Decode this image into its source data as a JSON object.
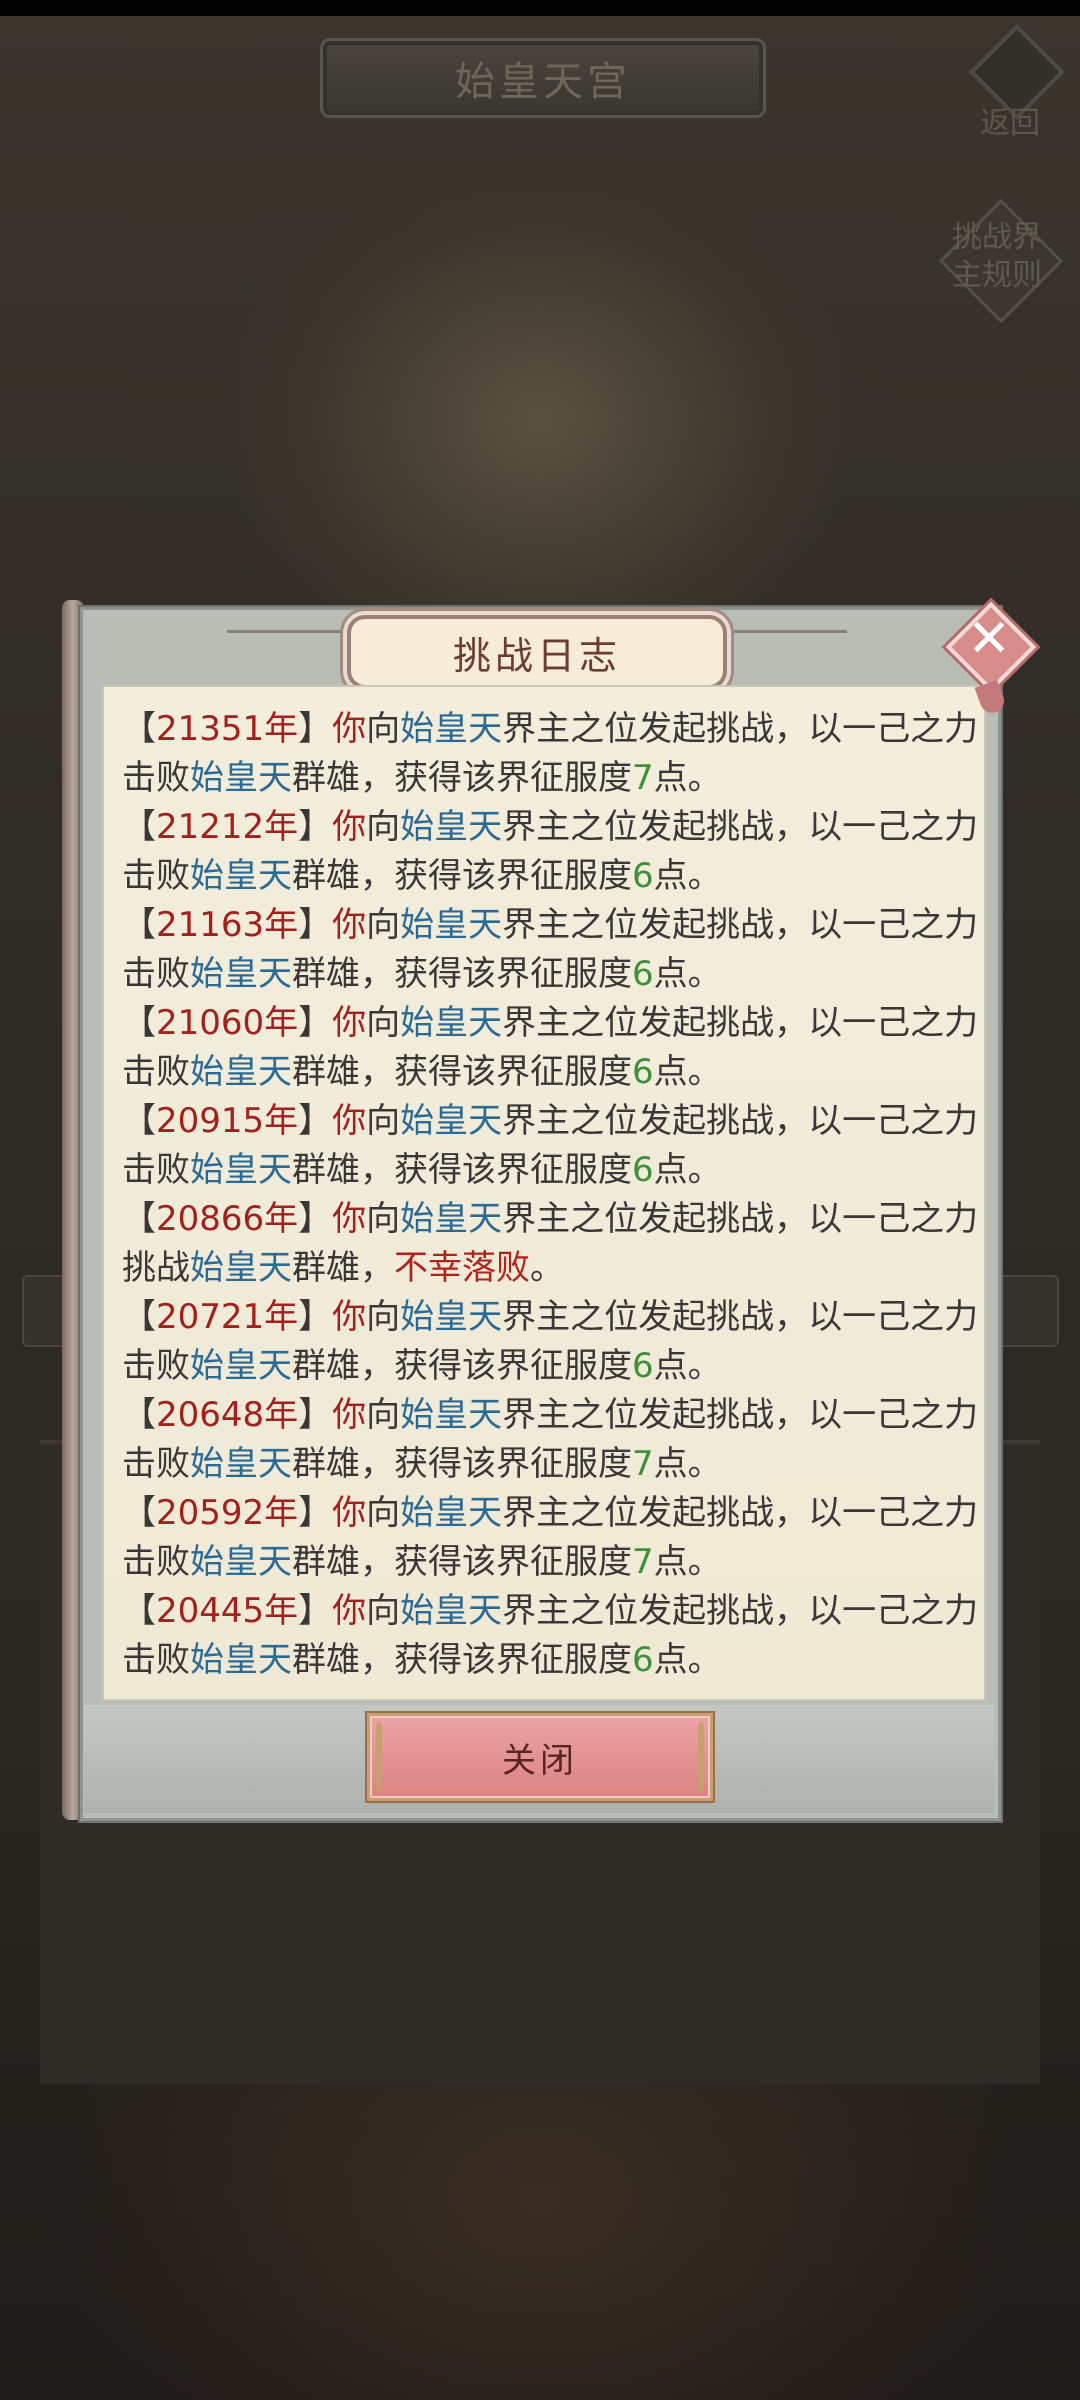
{
  "header": {
    "title": "始皇天宫",
    "back_label": "返回",
    "rules_label": "挑战界主规则"
  },
  "dialog": {
    "title": "挑战日志",
    "close_label": "关闭",
    "entries": [
      {
        "year": "21351年",
        "result": "win",
        "points": "7"
      },
      {
        "year": "21212年",
        "result": "win",
        "points": "6"
      },
      {
        "year": "21163年",
        "result": "win",
        "points": "6"
      },
      {
        "year": "21060年",
        "result": "win",
        "points": "6"
      },
      {
        "year": "20915年",
        "result": "win",
        "points": "6"
      },
      {
        "year": "20866年",
        "result": "loss",
        "points": ""
      },
      {
        "year": "20721年",
        "result": "win",
        "points": "6"
      },
      {
        "year": "20648年",
        "result": "win",
        "points": "7"
      },
      {
        "year": "20592年",
        "result": "win",
        "points": "7"
      },
      {
        "year": "20445年",
        "result": "win",
        "points": "6"
      }
    ],
    "text": {
      "bracket_open": "【",
      "bracket_close": "】",
      "you": "你",
      "to": "向",
      "realm": "始皇天",
      "challenge_part": "界主之位发起挑战，以一己之力",
      "win_verb": "击败",
      "loss_verb": "挑战",
      "heroes": "群雄，",
      "gain": "获得该界征服度",
      "points_suffix": "点。",
      "fail": "不幸落败",
      "fail_suffix": "。"
    }
  },
  "colors": {
    "year": "#a3201c",
    "realm": "#2c6a96",
    "points": "#3f8f3a",
    "fail": "#b0221c"
  }
}
